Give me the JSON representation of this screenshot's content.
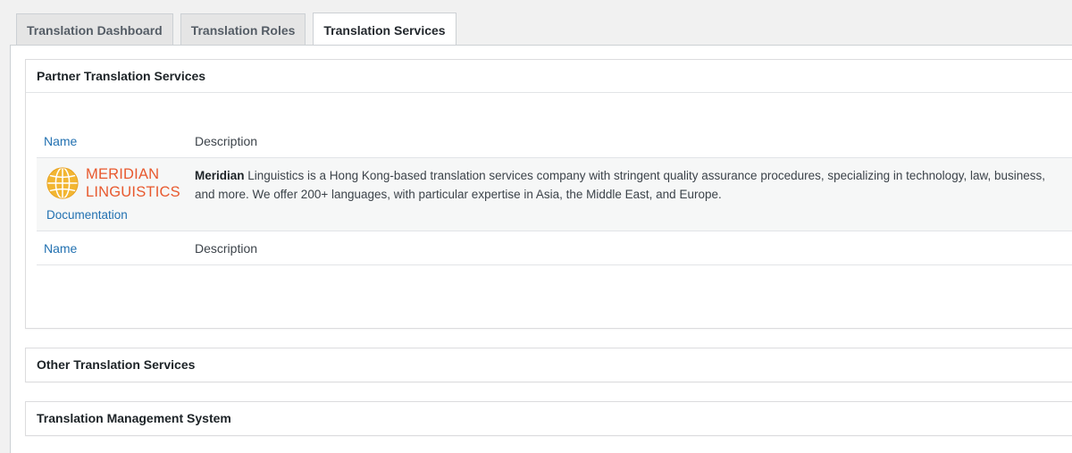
{
  "tabs": [
    {
      "label": "Translation Dashboard",
      "active": false
    },
    {
      "label": "Translation Roles",
      "active": false
    },
    {
      "label": "Translation Services",
      "active": true
    }
  ],
  "sections": {
    "partner": {
      "title": "Partner Translation Services",
      "columns": {
        "name": "Name",
        "description": "Description"
      },
      "services": [
        {
          "logo_line1": "MERIDIAN",
          "logo_line2": "LINGUISTICS",
          "documentation_label": "Documentation",
          "description_bold": "Meridian",
          "description_rest": " Linguistics is a Hong Kong-based translation services company with stringent quality assurance procedures, specializing in technology, law, business, and more. We offer 200+ languages, with particular expertise in Asia, the Middle East, and Europe."
        }
      ]
    },
    "other": {
      "title": "Other Translation Services"
    },
    "tms": {
      "title": "Translation Management System"
    }
  },
  "colors": {
    "link": "#2271b1",
    "logo_orange": "#e8592e",
    "globe_yellow": "#f2b632"
  },
  "icons": [
    "globe-logo-icon"
  ]
}
